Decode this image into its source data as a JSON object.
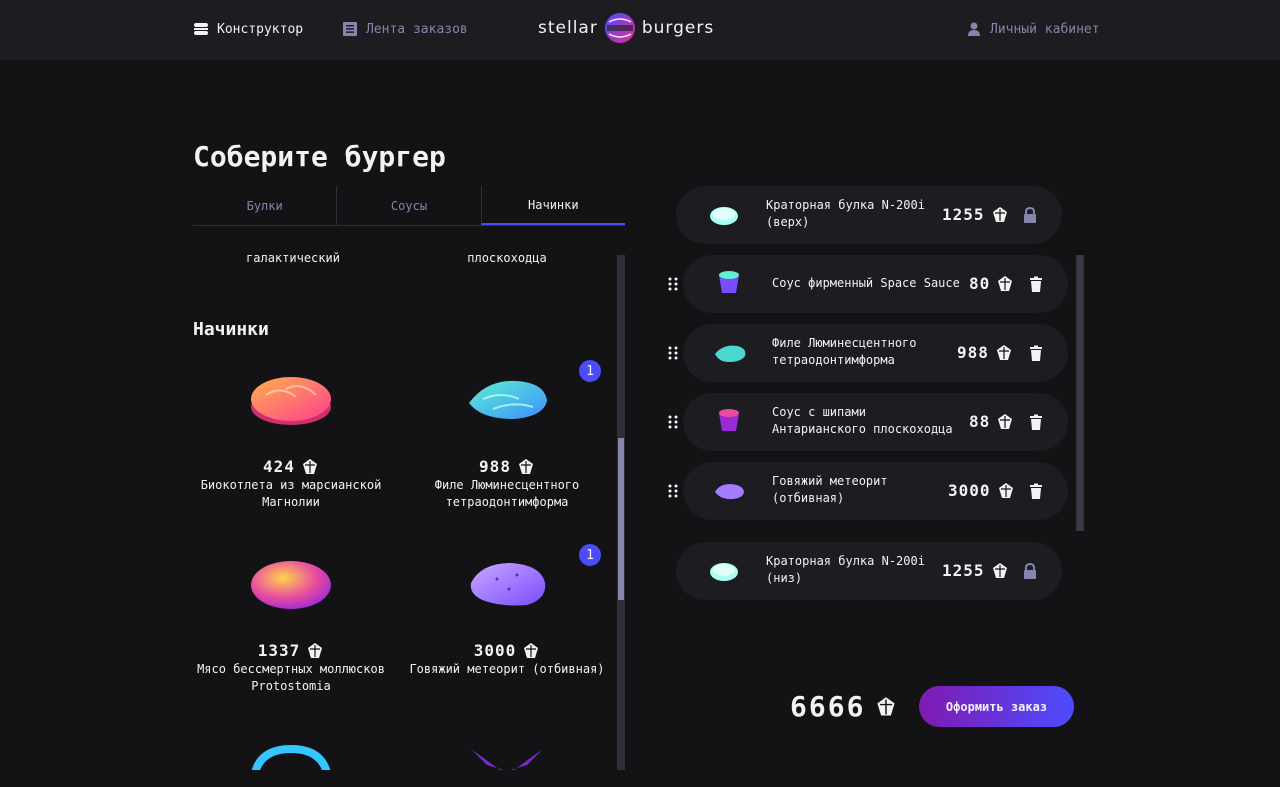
{
  "header": {
    "nav_constructor": "Конструктор",
    "nav_feed": "Лента заказов",
    "nav_account": "Личный кабинет",
    "logo_left": "stellar",
    "logo_right": "burgers"
  },
  "page_title": "Соберите бургер",
  "tabs": [
    "Булки",
    "Соусы",
    "Начинки"
  ],
  "active_tab": "Начинки",
  "ingredients": {
    "partial_names": [
      "галактический",
      "плоскоходца"
    ],
    "section_title": "Начинки",
    "cards": [
      {
        "price": "424",
        "name": "Биокотлета из марсианской Магнолии",
        "count": null
      },
      {
        "price": "988",
        "name": "Филе Люминесцентного тетраодонтимформа",
        "count": "1"
      },
      {
        "price": "1337",
        "name": "Мясо бессмертных моллюсков Protostomia",
        "count": null
      },
      {
        "price": "3000",
        "name": "Говяжий метеорит (отбивная)",
        "count": "1"
      }
    ]
  },
  "constructor": {
    "bun_top": {
      "name": "Краторная булка N-200i (верх)",
      "price": "1255"
    },
    "fillings": [
      {
        "name": "Соус фирменный Space Sauce",
        "price": "80"
      },
      {
        "name": "Филе Люминесцентного тетраодонтимформа",
        "price": "988"
      },
      {
        "name": "Соус с шипами Антарианского плоскоходца",
        "price": "88"
      },
      {
        "name": "Говяжий метеорит (отбивная)",
        "price": "3000"
      }
    ],
    "bun_bottom": {
      "name": "Краторная булка N-200i (низ)",
      "price": "1255"
    }
  },
  "total": "6666",
  "order_button": "Оформить заказ",
  "colors": {
    "accent": "#4c4cff",
    "bg": "#131316",
    "panel": "#1c1c21",
    "muted": "#8585ad"
  }
}
